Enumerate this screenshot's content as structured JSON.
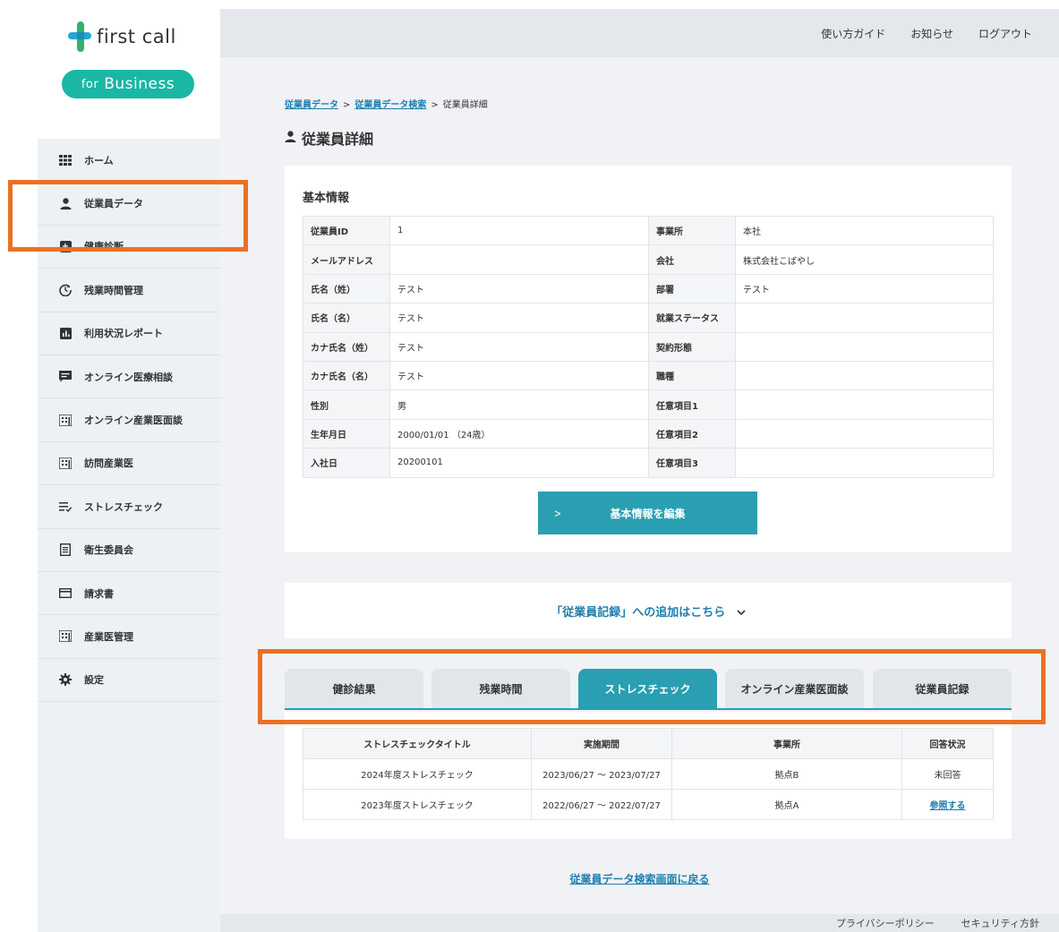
{
  "logo": {
    "name": "first call",
    "badge_prefix": "for",
    "badge_text": "Business"
  },
  "sidebar": {
    "items": [
      {
        "label": "ホーム",
        "icon": "grid-icon"
      },
      {
        "label": "従業員データ",
        "icon": "person-icon"
      },
      {
        "label": "健康診断",
        "icon": "plus-icon"
      },
      {
        "label": "残業時間管理",
        "icon": "clock-icon"
      },
      {
        "label": "利用状況レポート",
        "icon": "chart-icon"
      },
      {
        "label": "オンライン医療相談",
        "icon": "chat-icon"
      },
      {
        "label": "オンライン産業医面談",
        "icon": "building-icon"
      },
      {
        "label": "訪問産業医",
        "icon": "building-icon"
      },
      {
        "label": "ストレスチェック",
        "icon": "check-list-icon"
      },
      {
        "label": "衛生委員会",
        "icon": "document-icon"
      },
      {
        "label": "請求書",
        "icon": "card-icon"
      },
      {
        "label": "産業医管理",
        "icon": "building-icon"
      },
      {
        "label": "設定",
        "icon": "gear-icon"
      }
    ]
  },
  "header": {
    "guide": "使い方ガイド",
    "notice": "お知らせ",
    "logout": "ログアウト"
  },
  "breadcrumb": {
    "item1": "従業員データ",
    "item2": "従業員データ検索",
    "current": "従業員詳細",
    "separator": ">"
  },
  "page_title": "従業員詳細",
  "basic_info": {
    "title": "基本情報",
    "rows": [
      {
        "l1": "従業員ID",
        "v1": "1",
        "l2": "事業所",
        "v2": "本社"
      },
      {
        "l1": "メールアドレス",
        "v1": "",
        "l2": "会社",
        "v2": "株式会社こばやし"
      },
      {
        "l1": "氏名（姓）",
        "v1": "テスト",
        "l2": "部署",
        "v2": "テスト"
      },
      {
        "l1": "氏名（名）",
        "v1": "テスト",
        "l2": "就業ステータス",
        "v2": ""
      },
      {
        "l1": "カナ氏名（姓）",
        "v1": "テスト",
        "l2": "契約形態",
        "v2": ""
      },
      {
        "l1": "カナ氏名（名）",
        "v1": "テスト",
        "l2": "職種",
        "v2": ""
      },
      {
        "l1": "性別",
        "v1": "男",
        "l2": "任意項目1",
        "v2": ""
      },
      {
        "l1": "生年月日",
        "v1": "2000/01/01 （24歳）",
        "l2": "任意項目2",
        "v2": ""
      },
      {
        "l1": "入社日",
        "v1": "20200101",
        "l2": "任意項目3",
        "v2": ""
      }
    ],
    "edit_button": "基本情報を編集"
  },
  "add_record": "「従業員記録」への追加はこちら",
  "tabs": [
    {
      "label": "健診結果",
      "active": false
    },
    {
      "label": "残業時間",
      "active": false
    },
    {
      "label": "ストレスチェック",
      "active": true
    },
    {
      "label": "オンライン産業医面談",
      "active": false
    },
    {
      "label": "従業員記録",
      "active": false
    }
  ],
  "stress_table": {
    "headers": [
      "ストレスチェックタイトル",
      "実施期間",
      "事業所",
      "回答状況"
    ],
    "rows": [
      {
        "title": "2024年度ストレスチェック",
        "period": "2023/06/27 ～ 2023/07/27",
        "office": "拠点B",
        "status": "未回答"
      },
      {
        "title": "2023年度ストレスチェック",
        "period": "2022/06/27 ～ 2022/07/27",
        "office": "拠点A",
        "status": "参照する"
      }
    ]
  },
  "back_link": "従業員データ検索画面に戻る",
  "footer": {
    "privacy": "プライバシーポリシー",
    "security": "セキュリティ方針"
  },
  "colors": {
    "accent": "#2a9fb1",
    "highlight": "#ec7024",
    "badge": "#19b7a4"
  }
}
